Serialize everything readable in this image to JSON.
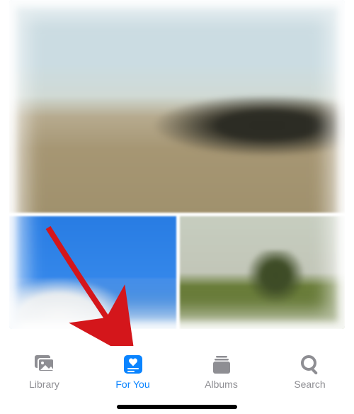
{
  "tab_bar": {
    "items": [
      {
        "id": "library",
        "label": "Library",
        "active": false
      },
      {
        "id": "for_you",
        "label": "For You",
        "active": true
      },
      {
        "id": "albums",
        "label": "Albums",
        "active": false
      },
      {
        "id": "search",
        "label": "Search",
        "active": false
      }
    ]
  },
  "colors": {
    "accent": "#0a84ff",
    "inactive": "#8e8e93"
  },
  "photos": {
    "featured": "landscape-dune",
    "thumbnails": [
      "blue-sky-rock",
      "field-tree"
    ]
  },
  "annotation": {
    "arrow_target": "tab-for-you"
  }
}
